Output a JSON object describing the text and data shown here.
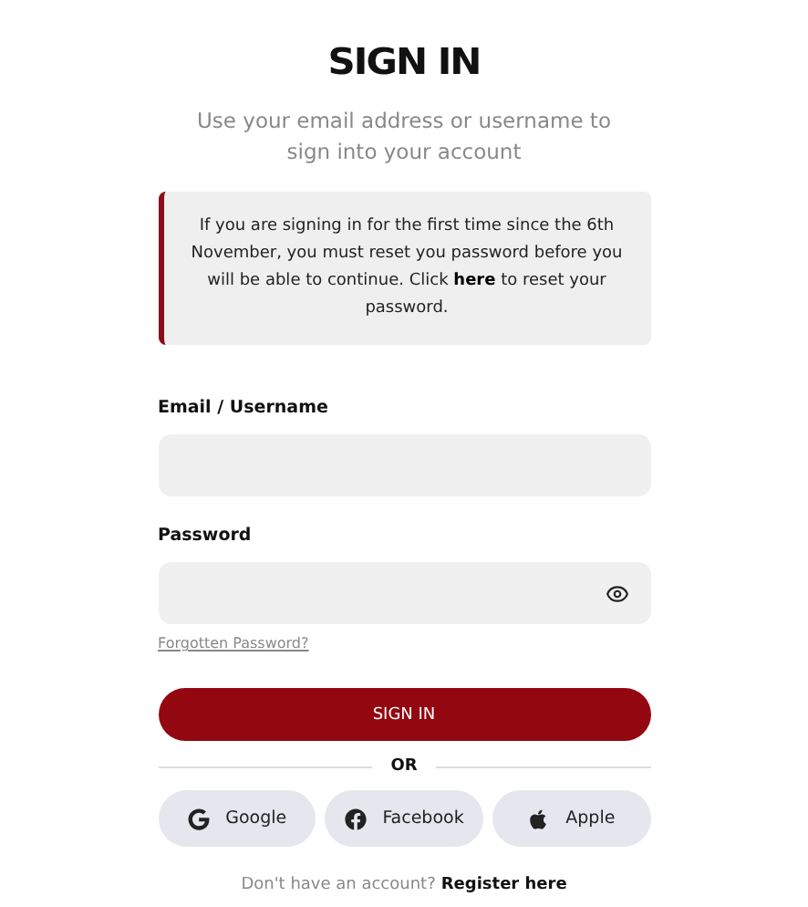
{
  "title": "SIGN IN",
  "subtitle": "Use your email address or username to sign into your account",
  "notice": "If you are signing in for the first time since the 6th November, you must reset you password before you will be able to continue. Click **here** to reset your password.",
  "fields": [
    {
      "label": "Email / Username",
      "kind": "text"
    },
    {
      "label": "Password",
      "kind": "password"
    }
  ],
  "forgot_link": "Forgotten Password?",
  "submit": "SIGN IN",
  "divider": "OR",
  "social": [
    {
      "label": "Google",
      "kind": "google"
    },
    {
      "label": "Facebook",
      "kind": "facebook"
    },
    {
      "label": "Apple",
      "kind": "apple"
    }
  ],
  "register": {
    "prompt": "Don't have an account?",
    "link": "Register here"
  }
}
